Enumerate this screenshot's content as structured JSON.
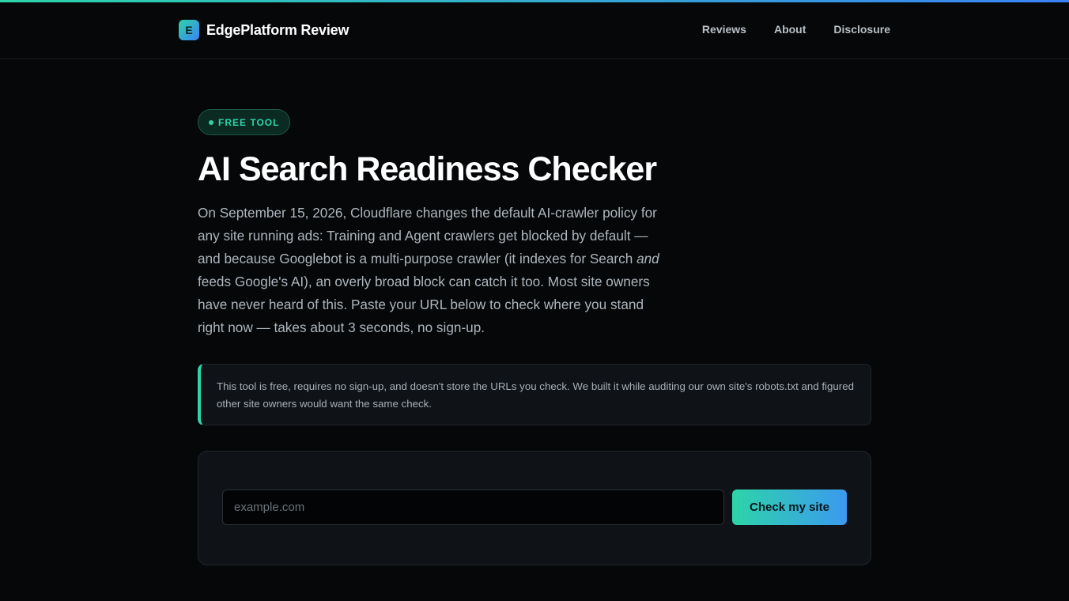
{
  "brand": {
    "logo_letter": "E",
    "name": "EdgePlatform Review"
  },
  "nav": {
    "items": [
      {
        "label": "Reviews"
      },
      {
        "label": "About"
      },
      {
        "label": "Disclosure"
      }
    ]
  },
  "hero": {
    "badge": "FREE TOOL",
    "title": "AI Search Readiness Checker",
    "intro_part1": "On September 15, 2026, Cloudflare changes the default AI-crawler policy for any site running ads: Training and Agent crawlers get blocked by default — and because Googlebot is a multi-purpose crawler (it indexes for Search ",
    "intro_emphasis": "and",
    "intro_part2": " feeds Google's AI), an overly broad block can catch it too. Most site owners have never heard of this. Paste your URL below to check where you stand right now — takes about 3 seconds, no sign-up."
  },
  "notice": {
    "text": "This tool is free, requires no sign-up, and doesn't store the URLs you check. We built it while auditing our own site's robots.txt and figured other site owners would want the same check."
  },
  "checker": {
    "input_value": "",
    "input_placeholder": "example.com",
    "button_label": "Check my site"
  },
  "colors": {
    "accent_start": "#2dd4a8",
    "accent_end": "#3b82f6",
    "background": "#050708"
  }
}
